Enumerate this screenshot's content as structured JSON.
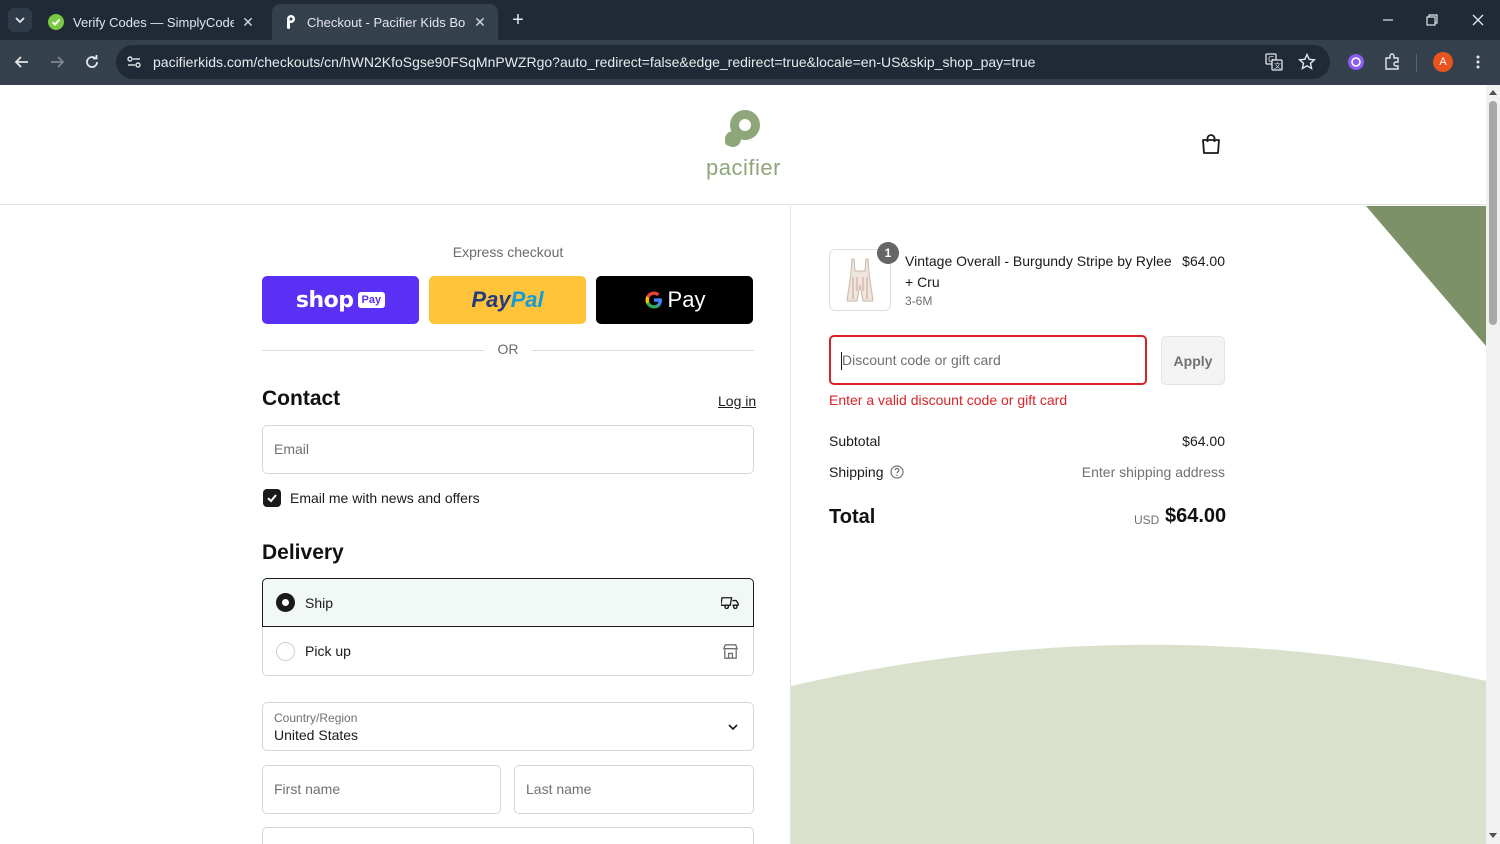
{
  "browser": {
    "tabs": [
      {
        "title": "Verify Codes — SimplyCodes",
        "active": false
      },
      {
        "title": "Checkout - Pacifier Kids Boutique",
        "active": true
      }
    ],
    "url": "pacifierkids.com/checkouts/cn/hWN2KfoSgse90FSqMnPWZRgo?auto_redirect=false&edge_redirect=true&locale=en-US&skip_shop_pay=true",
    "profile_initial": "A"
  },
  "header": {
    "logo_text": "pacifier"
  },
  "express": {
    "label": "Express checkout",
    "shop_word": "shop",
    "shop_pay": "Pay",
    "paypal_a": "Pay",
    "paypal_b": "Pal",
    "gpay_word": "Pay",
    "or_text": "OR"
  },
  "contact": {
    "title": "Contact",
    "login_link": "Log in",
    "email_placeholder": "Email",
    "newsletter_label": "Email me with news and offers",
    "newsletter_checked": true
  },
  "delivery": {
    "title": "Delivery",
    "options": [
      {
        "label": "Ship",
        "selected": true,
        "icon": "truck-icon"
      },
      {
        "label": "Pick up",
        "selected": false,
        "icon": "store-icon"
      }
    ],
    "country_label": "Country/Region",
    "country_value": "United States",
    "first_name_placeholder": "First name",
    "last_name_placeholder": "Last name"
  },
  "order": {
    "item": {
      "quantity": "1",
      "name": "Vintage Overall - Burgundy Stripe by Rylee + Cru",
      "variant": "3-6M",
      "price": "$64.00"
    },
    "discount_placeholder": "Discount code or gift card",
    "apply_label": "Apply",
    "error": "Enter a valid discount code or gift card",
    "subtotal_label": "Subtotal",
    "subtotal_value": "$64.00",
    "shipping_label": "Shipping",
    "shipping_value": "Enter shipping address",
    "total_label": "Total",
    "total_currency": "USD",
    "total_value": "$64.00"
  },
  "colors": {
    "accent_brand": "#8fa57a",
    "shop_pay": "#5a31f4",
    "paypal": "#ffc439",
    "error": "#d8232a"
  }
}
